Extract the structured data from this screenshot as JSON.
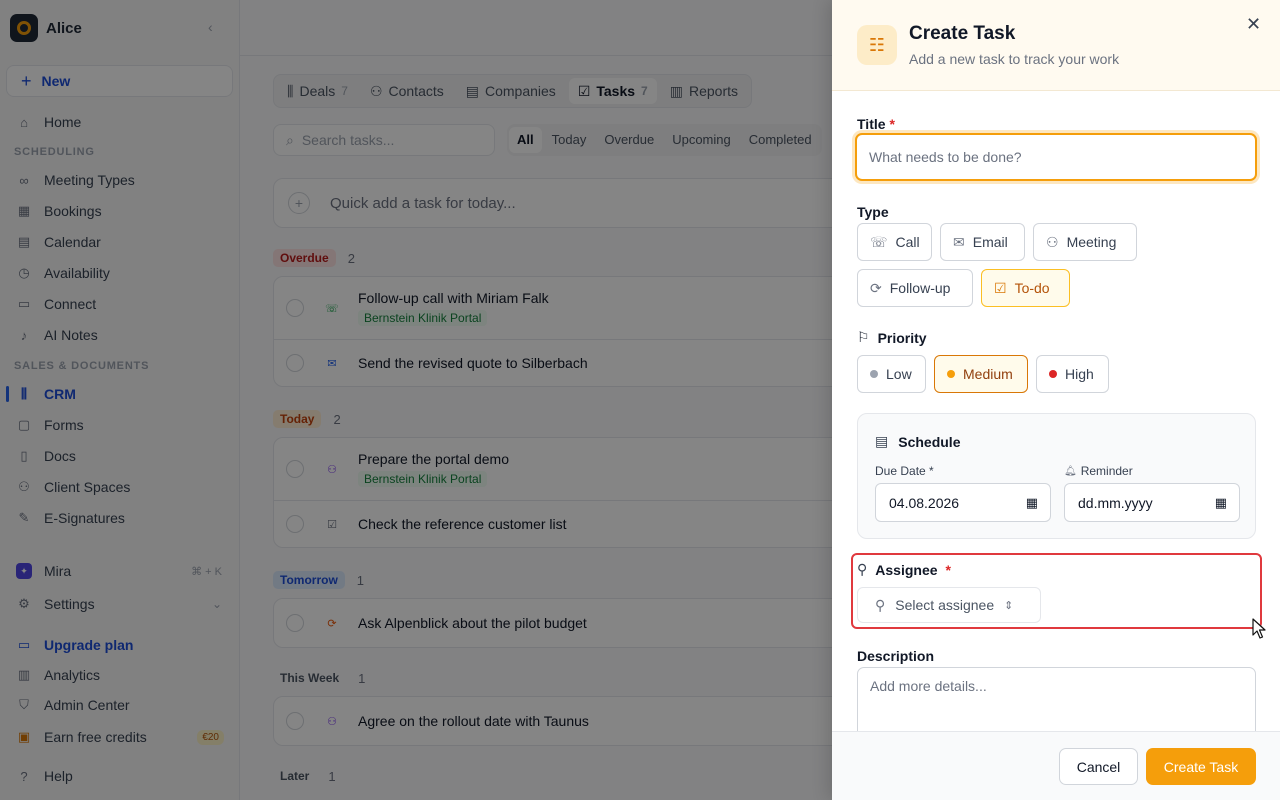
{
  "workspace": {
    "name": "Alice"
  },
  "sidebar": {
    "new_label": "New",
    "home": "Home",
    "section_scheduling": "SCHEDULING",
    "scheduling_items": [
      "Meeting Types",
      "Bookings",
      "Calendar",
      "Availability",
      "Connect",
      "AI Notes"
    ],
    "section_sales": "SALES & DOCUMENTS",
    "sales_items": [
      "CRM",
      "Forms",
      "Docs",
      "Client Spaces",
      "E-Signatures"
    ],
    "mira": "Mira",
    "mira_shortcut": "⌘ + K",
    "settings": "Settings",
    "upgrade": "Upgrade plan",
    "analytics": "Analytics",
    "admin": "Admin Center",
    "credits": "Earn free credits",
    "credits_badge": "€20",
    "help": "Help"
  },
  "tabs": [
    {
      "label": "Deals",
      "count": "7"
    },
    {
      "label": "Contacts",
      "count": ""
    },
    {
      "label": "Companies",
      "count": ""
    },
    {
      "label": "Tasks",
      "count": "7"
    },
    {
      "label": "Reports",
      "count": ""
    }
  ],
  "search": {
    "placeholder": "Search tasks..."
  },
  "filters": [
    "All",
    "Today",
    "Overdue",
    "Upcoming",
    "Completed"
  ],
  "quick_add": {
    "placeholder": "Quick add a task for today..."
  },
  "groups": [
    {
      "label": "Overdue",
      "count": "2"
    },
    {
      "label": "Today",
      "count": "2"
    },
    {
      "label": "Tomorrow",
      "count": "1"
    },
    {
      "label": "This Week",
      "count": "1"
    },
    {
      "label": "Later",
      "count": "1"
    }
  ],
  "tasks": [
    {
      "title": "Follow-up call with Miriam Falk",
      "tag": "Bernstein Klinik Portal"
    },
    {
      "title": "Send the revised quote to Silberbach",
      "tag": ""
    },
    {
      "title": "Prepare the portal demo",
      "tag": "Bernstein Klinik Portal"
    },
    {
      "title": "Check the reference customer list",
      "tag": ""
    },
    {
      "title": "Ask Alpenblick about the pilot budget",
      "tag": ""
    },
    {
      "title": "Agree on the rollout date with Taunus",
      "tag": ""
    }
  ],
  "panel": {
    "title": "Create Task",
    "subtitle": "Add a new task to track your work",
    "title_label": "Title",
    "required_mark": "*",
    "title_placeholder": "What needs to be done?",
    "type_label": "Type",
    "types": [
      "Call",
      "Email",
      "Meeting",
      "Follow-up",
      "To-do"
    ],
    "selected_type": "To-do",
    "priority_label": "Priority",
    "priorities": [
      "Low",
      "Medium",
      "High"
    ],
    "selected_priority": "Medium",
    "schedule_label": "Schedule",
    "due_label": "Due Date *",
    "due_value": "04.08.2026",
    "reminder_label": "Reminder",
    "reminder_value": "dd.mm.yyyy",
    "assignee_label": "Assignee",
    "assignee_placeholder": "Select assignee",
    "description_label": "Description",
    "description_placeholder": "Add more details...",
    "cancel": "Cancel",
    "create": "Create Task"
  },
  "colors": {
    "accent": "#f59e0b",
    "brand": "#1d4ed8",
    "highlight": "#e0393e"
  }
}
